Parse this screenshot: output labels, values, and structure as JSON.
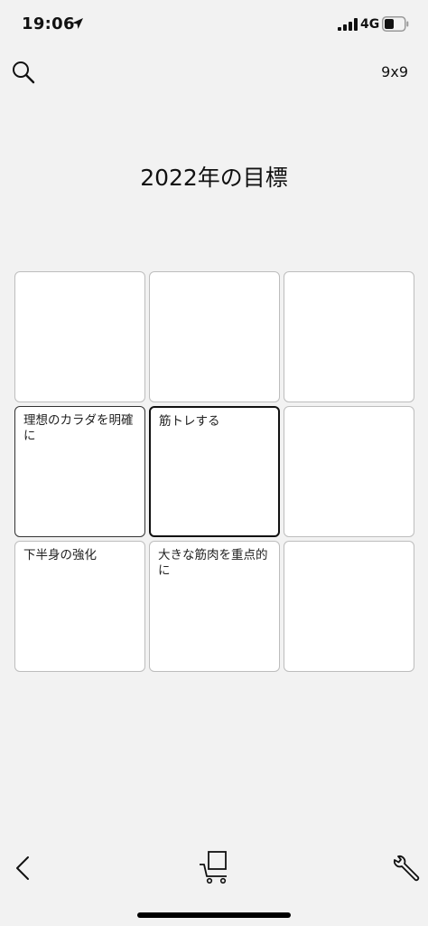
{
  "status_bar": {
    "time": "19:06",
    "network": "4G",
    "location_icon": "location-arrow-icon",
    "signal_icon": "cellular-signal-icon",
    "battery_icon": "battery-icon"
  },
  "header": {
    "search_icon": "search-icon",
    "grid_size": "9x9"
  },
  "title": "2022年の目標",
  "grid": {
    "cells": [
      {
        "text": ""
      },
      {
        "text": ""
      },
      {
        "text": ""
      },
      {
        "text": "理想のカラダを明確に"
      },
      {
        "text": "筋トレする"
      },
      {
        "text": ""
      },
      {
        "text": "下半身の強化"
      },
      {
        "text": "大きな筋肉を重点的に"
      },
      {
        "text": ""
      }
    ]
  },
  "toolbar": {
    "back_icon": "chevron-left-icon",
    "cart_icon": "cart-icon",
    "wrench_icon": "wrench-icon"
  },
  "colors": {
    "background": "#f2f2f2",
    "cell_background": "#ffffff",
    "cell_border": "#bdbdbd",
    "center_border": "#111111"
  }
}
